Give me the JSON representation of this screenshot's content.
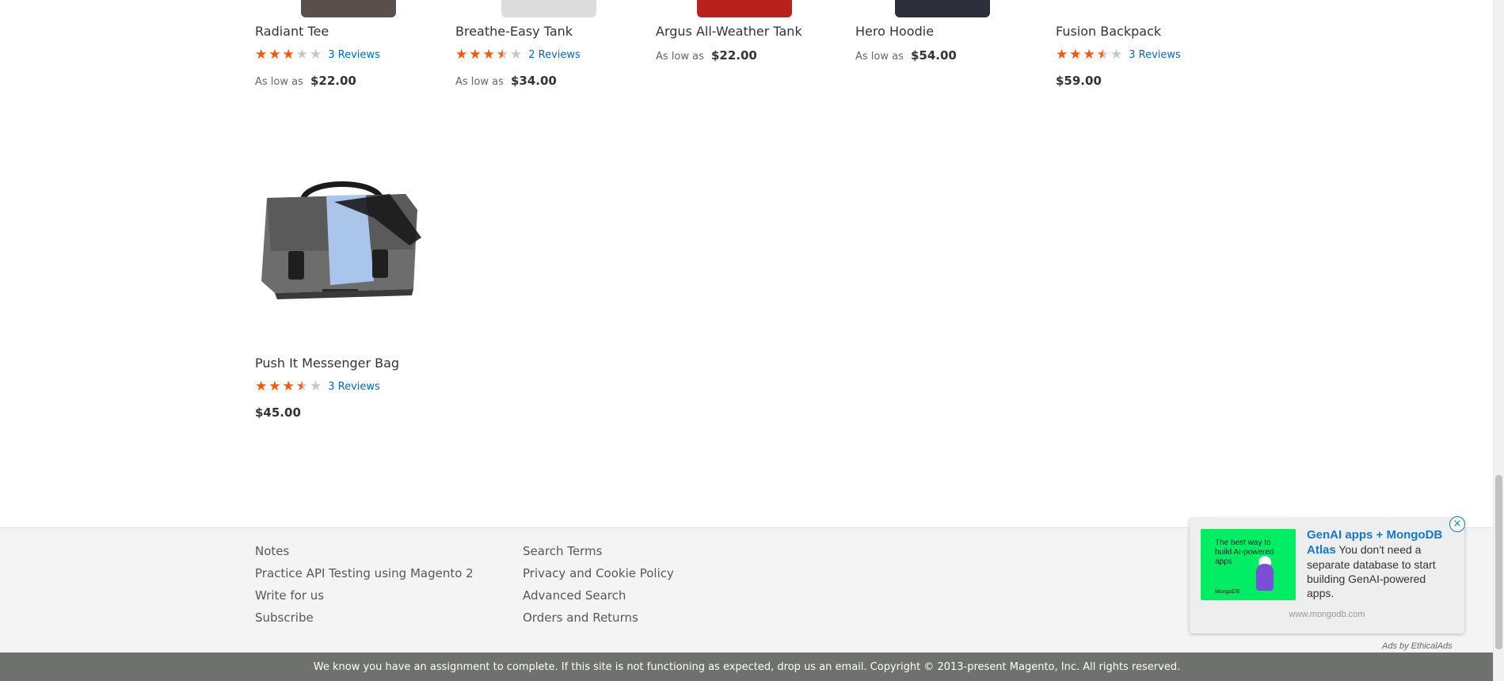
{
  "products_row1": [
    {
      "name": "Radiant Tee",
      "rating_pct": 60,
      "reviews": "3 Reviews",
      "price_prefix": "As low as",
      "price": "$22.00"
    },
    {
      "name": "Breathe-Easy Tank",
      "rating_pct": 70,
      "reviews": "2 Reviews",
      "price_prefix": "As low as",
      "price": "$34.00"
    },
    {
      "name": "Argus All-Weather Tank",
      "price_prefix": "As low as",
      "price": "$22.00"
    },
    {
      "name": "Hero Hoodie",
      "price_prefix": "As low as",
      "price": "$54.00"
    },
    {
      "name": "Fusion Backpack",
      "rating_pct": 70,
      "reviews": "3 Reviews",
      "price": "$59.00"
    }
  ],
  "product_row2": {
    "name": "Push It Messenger Bag",
    "rating_pct": 70,
    "reviews": "3 Reviews",
    "price": "$45.00"
  },
  "footer": {
    "col1": [
      "Notes",
      "Practice API Testing using Magento 2",
      "Write for us",
      "Subscribe"
    ],
    "col2": [
      "Search Terms",
      "Privacy and Cookie Policy",
      "Advanced Search",
      "Orders and Returns"
    ],
    "copyright": "We know you have an assignment to complete. If this site is not functioning as expected, drop us an email. Copyright © 2013-present Magento, Inc. All rights reserved."
  },
  "ad": {
    "close": "×",
    "image_text": "The best way to build AI-powered apps",
    "image_brand": "MongoDB",
    "title": "GenAI apps + MongoDB Atlas",
    "body": " You don't need a separate database to start building GenAI-powered apps.",
    "domain": "www.mongodb.com",
    "attribution": "Ads by EthicalAds"
  },
  "colors": {
    "star": "#ff5501",
    "link": "#006bb4",
    "ad_green": "#00ed64"
  }
}
